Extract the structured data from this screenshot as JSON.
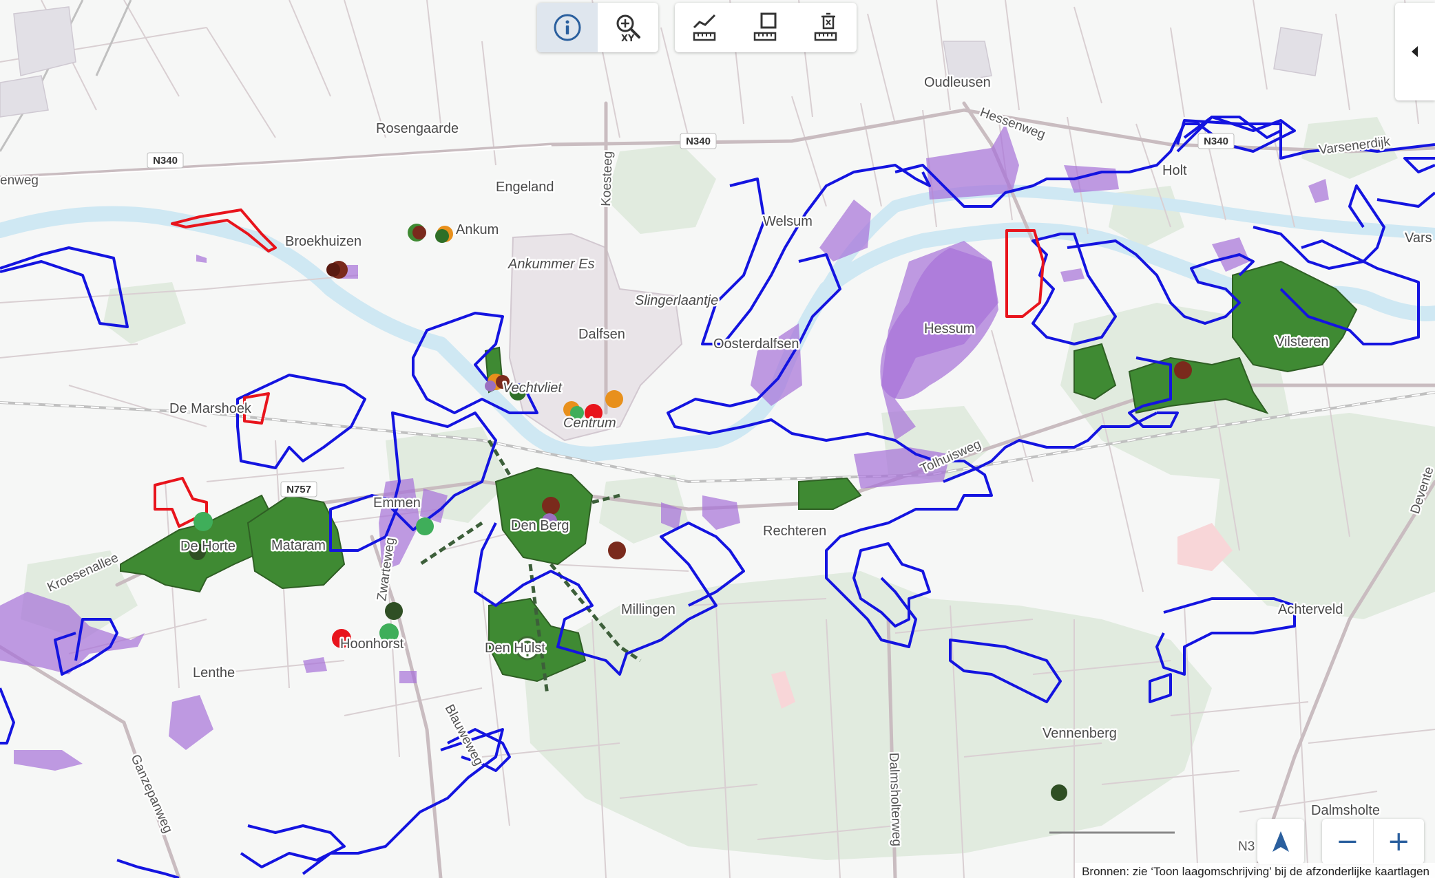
{
  "toolbar": {
    "info_button": "info",
    "zoom_xy_button": "XY",
    "measure_line_button": "measure-line",
    "measure_area_button": "measure-area",
    "measure_clear_button": "measure-clear"
  },
  "icons": {
    "info": "info-circle-icon",
    "zoom_xy": "magnifier-xy-icon",
    "measure_line": "ruler-line-icon",
    "measure_area": "ruler-square-icon",
    "measure_clear": "ruler-trash-icon",
    "panel": "caret-left-icon",
    "locate": "navigation-arrow-icon"
  },
  "controls": {
    "locate": "➤",
    "zoom_out": "−",
    "zoom_in": "+"
  },
  "map": {
    "places": [
      "Oudleusen",
      "Rosengaarde",
      "Engeland",
      "Broekhuizen",
      "Ankum",
      "Ankummer Es",
      "Welsum",
      "Slingerlaantje",
      "Dalfsen",
      "Oosterdalfsen",
      "Hessum",
      "Holt",
      "Vilsteren",
      "Vars",
      "De Marshoek",
      "Vechtvliet",
      "Centrum",
      "Emmen",
      "Mataram",
      "De Horte",
      "Den Berg",
      "Rechteren",
      "Millingen",
      "Achterveld",
      "Hoonhorst",
      "Lenthe",
      "Den Hulst",
      "Vennenberg",
      "Dalmsholte"
    ],
    "roads": [
      "N340",
      "N340",
      "N340",
      "N757",
      "Hessenweg",
      "Varsenerdijk",
      "Koesteeg",
      "Kroesenallee",
      "Zwarteweg",
      "Blauweweg",
      "Ganzepanweg",
      "Dalmsholterweg",
      "Tolhuisweg",
      "Devente",
      "enweg",
      "N3"
    ]
  },
  "colors": {
    "protected_boundary": "#1414e0",
    "forest": "#3f8a33",
    "habitat": "#a770d8",
    "red_parcel": "#e8141c",
    "water": "#cfe8f3",
    "green_background": "#e1ebdf"
  },
  "attribution": "Bronnen: zie ‘Toon laagomschrijving’ bij de afzonderlijke kaartlagen"
}
